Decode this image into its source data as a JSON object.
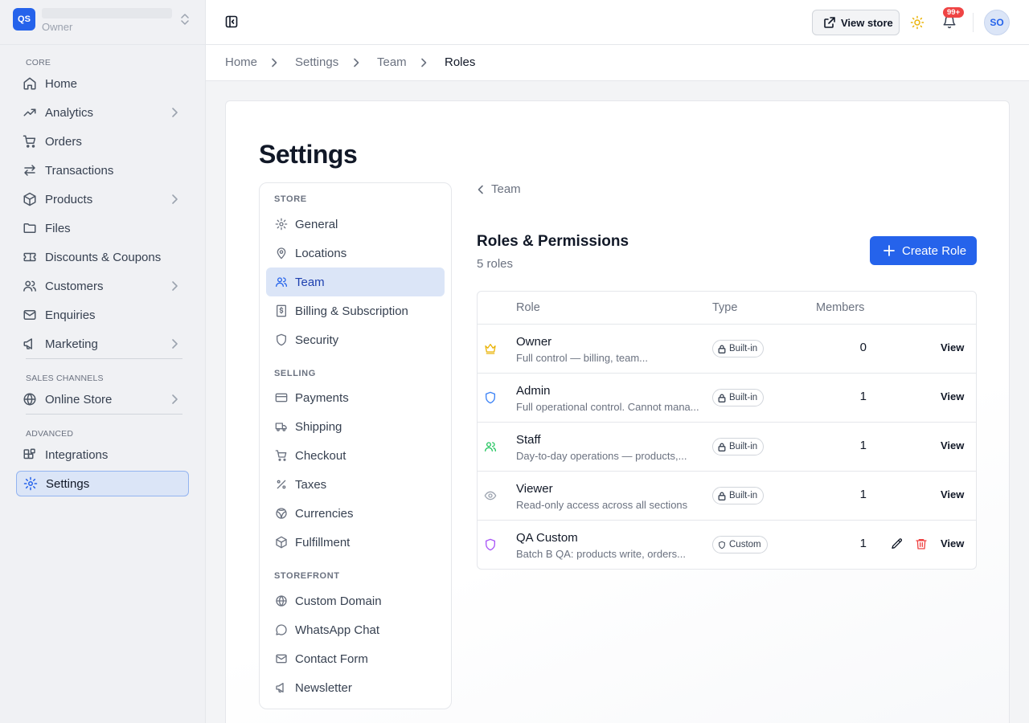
{
  "store": {
    "logo": "QS",
    "role": "Owner"
  },
  "sidebar": {
    "sections": [
      "CORE",
      "SALES CHANNELS",
      "ADVANCED"
    ],
    "items": [
      {
        "label": "Home",
        "icon": "home-icon"
      },
      {
        "label": "Analytics",
        "icon": "trending-up-icon",
        "expandable": true
      },
      {
        "label": "Orders",
        "icon": "cart-icon"
      },
      {
        "label": "Transactions",
        "icon": "arrows-left-right-icon"
      },
      {
        "label": "Products",
        "icon": "box-icon",
        "expandable": true
      },
      {
        "label": "Files",
        "icon": "folder-icon"
      },
      {
        "label": "Discounts & Coupons",
        "icon": "ticket-icon"
      },
      {
        "label": "Customers",
        "icon": "users-icon",
        "expandable": true
      },
      {
        "label": "Enquiries",
        "icon": "mail-icon"
      },
      {
        "label": "Marketing",
        "icon": "megaphone-icon",
        "expandable": true
      },
      {
        "label": "Online Store",
        "icon": "globe-icon",
        "expandable": true
      },
      {
        "label": "Integrations",
        "icon": "blocks-icon"
      },
      {
        "label": "Settings",
        "icon": "gear-icon",
        "active": true
      }
    ]
  },
  "topbar": {
    "view_store_label": "View store",
    "notifications_badge": "99+",
    "avatar_initials": "SO"
  },
  "breadcrumb": [
    "Home",
    "Settings",
    "Team",
    "Roles"
  ],
  "page": {
    "title": "Settings"
  },
  "settings_nav": {
    "sections": [
      "STORE",
      "SELLING",
      "STOREFRONT"
    ],
    "items": [
      {
        "label": "General",
        "icon": "gear-icon"
      },
      {
        "label": "Locations",
        "icon": "map-pin-icon"
      },
      {
        "label": "Team",
        "icon": "users-icon",
        "active": true
      },
      {
        "label": "Billing & Subscription",
        "icon": "receipt-icon"
      },
      {
        "label": "Security",
        "icon": "shield-icon"
      },
      {
        "label": "Payments",
        "icon": "credit-card-icon"
      },
      {
        "label": "Shipping",
        "icon": "truck-icon"
      },
      {
        "label": "Checkout",
        "icon": "cart-icon"
      },
      {
        "label": "Taxes",
        "icon": "percent-icon"
      },
      {
        "label": "Currencies",
        "icon": "coins-icon"
      },
      {
        "label": "Fulfillment",
        "icon": "package-icon"
      },
      {
        "label": "Custom Domain",
        "icon": "globe-icon"
      },
      {
        "label": "WhatsApp Chat",
        "icon": "message-circle-icon"
      },
      {
        "label": "Contact Form",
        "icon": "mail-icon"
      },
      {
        "label": "Newsletter",
        "icon": "megaphone-icon"
      }
    ]
  },
  "roles": {
    "back_label": "Team",
    "title": "Roles & Permissions",
    "count_label": "5 roles",
    "create_label": "Create Role",
    "columns": [
      "Role",
      "Type",
      "Members"
    ],
    "rows": [
      {
        "name": "Owner",
        "description": "Full control — billing, team...",
        "type": "Built-in",
        "members": "0",
        "action": "View",
        "icon": "crown-icon",
        "icon_color": "#eab308"
      },
      {
        "name": "Admin",
        "description": "Full operational control. Cannot mana...",
        "type": "Built-in",
        "members": "1",
        "action": "View",
        "icon": "shield-icon",
        "icon_color": "#3b82f6"
      },
      {
        "name": "Staff",
        "description": "Day-to-day operations — products,...",
        "type": "Built-in",
        "members": "1",
        "action": "View",
        "icon": "users-icon",
        "icon_color": "#22c55e"
      },
      {
        "name": "Viewer",
        "description": "Read-only access across all sections",
        "type": "Built-in",
        "members": "1",
        "action": "View",
        "icon": "eye-icon",
        "icon_color": "#9ca3af"
      },
      {
        "name": "QA Custom",
        "description": "Batch B QA: products write, orders...",
        "type": "Custom",
        "members": "1",
        "action": "View",
        "icon": "shield-icon",
        "icon_color": "#a855f7"
      }
    ]
  },
  "colors": {
    "accent": "#2563eb",
    "danger": "#ef4444",
    "badge": "#ef4444"
  }
}
